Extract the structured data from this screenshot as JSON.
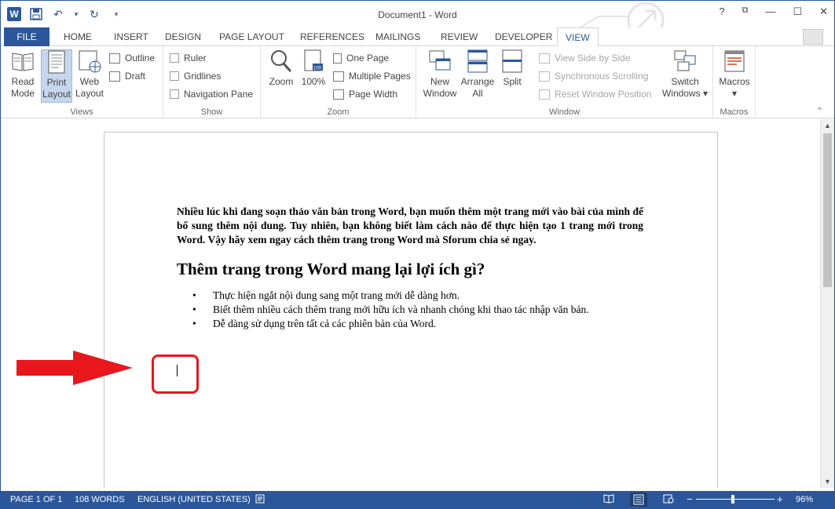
{
  "app": {
    "title": "Document1 - Word"
  },
  "titlebar": {
    "help": "?",
    "minimize": "—",
    "maximize": "☐",
    "close": "✕"
  },
  "tabs": [
    "FILE",
    "HOME",
    "INSERT",
    "DESIGN",
    "PAGE LAYOUT",
    "REFERENCES",
    "MAILINGS",
    "REVIEW",
    "DEVELOPER",
    "VIEW"
  ],
  "active_tab": "VIEW",
  "ribbon": {
    "views": {
      "label": "Views",
      "read_mode": "Read\nMode",
      "print_layout": "Print\nLayout",
      "web_layout": "Web\nLayout",
      "outline": "Outline",
      "draft": "Draft"
    },
    "show": {
      "label": "Show",
      "ruler": "Ruler",
      "gridlines": "Gridlines",
      "navigation_pane": "Navigation Pane"
    },
    "zoom": {
      "label": "Zoom",
      "zoom": "Zoom",
      "hundred": "100%",
      "one_page": "One Page",
      "multiple_pages": "Multiple Pages",
      "page_width": "Page Width"
    },
    "window": {
      "label": "Window",
      "new_window": "New\nWindow",
      "arrange_all": "Arrange\nAll",
      "split": "Split",
      "view_side_by_side": "View Side by Side",
      "synchronous_scrolling": "Synchronous Scrolling",
      "reset_window_position": "Reset Window Position",
      "switch_windows": "Switch\nWindows ▾"
    },
    "macros": {
      "label": "Macros",
      "macros": "Macros\n▾"
    }
  },
  "document": {
    "paragraph": "Nhiều lúc khi đang soạn thảo văn bản trong Word, bạn muốn thêm một trang mới vào bài của mình để bổ sung thêm nội dung. Tuy nhiên, bạn không biết làm cách nào để thực hiện tạo 1 trang mới trong Word. Vậy hãy xem ngay cách thêm trang trong Word mà Sforum chia sẻ ngay.",
    "heading": "Thêm trang trong Word mang lại lợi ích gì?",
    "bullets": [
      "Thực hiện ngắt nội dung sang một trang mới dễ dàng hơn.",
      "Biết thêm nhiều cách thêm trang mới hữu ích và nhanh chóng khi thao tác nhập văn bản.",
      "Dễ dàng sử dụng trên tất cả các phiên bản của Word."
    ]
  },
  "status": {
    "page": "PAGE 1 OF 1",
    "words": "108 WORDS",
    "language": "ENGLISH (UNITED STATES)",
    "zoom_minus": "−",
    "zoom_plus": "+",
    "zoom_level": "96%"
  },
  "colors": {
    "accent": "#2b579a",
    "highlight": "#e8161d"
  }
}
